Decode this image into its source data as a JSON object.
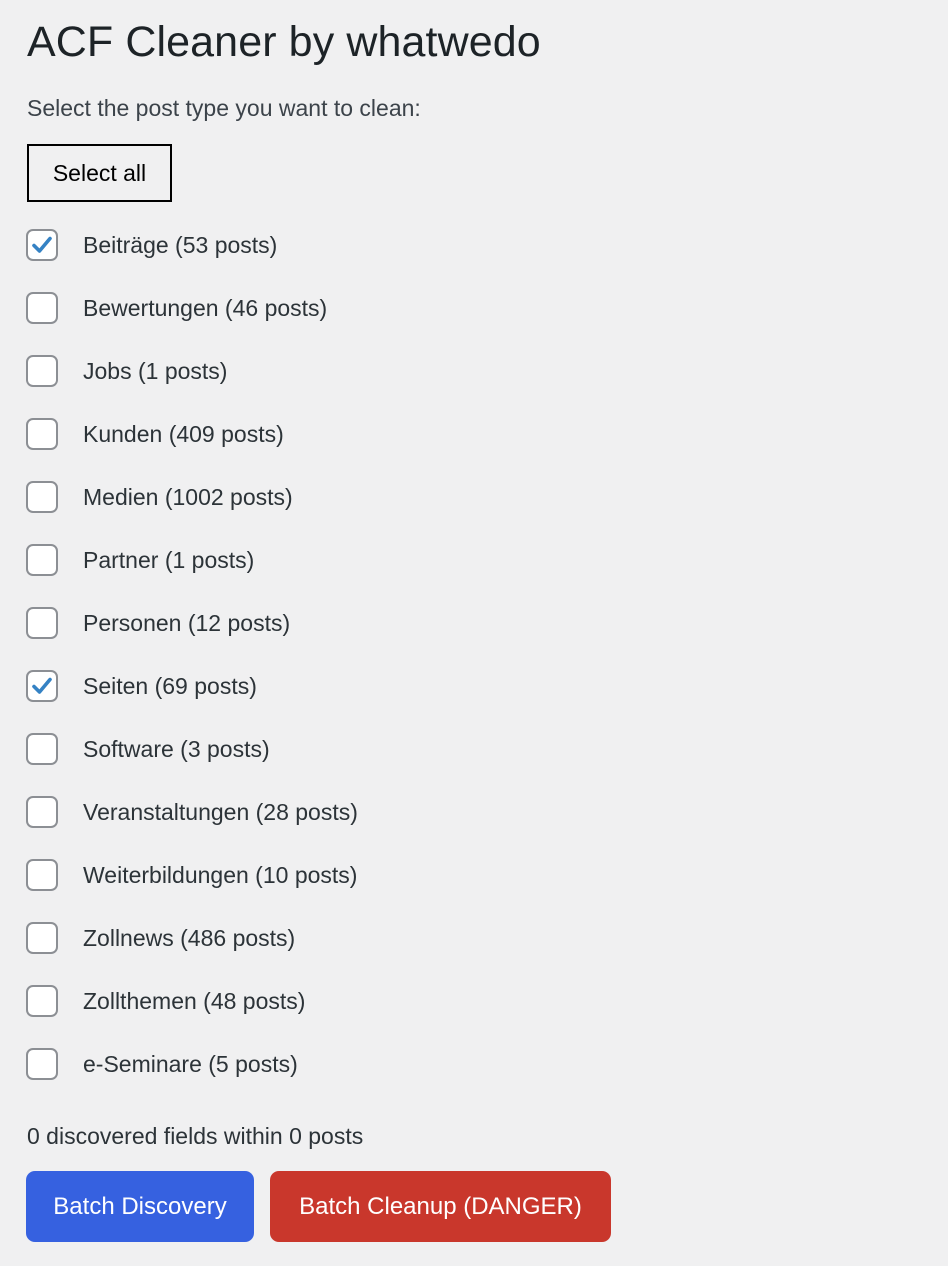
{
  "page": {
    "title": "ACF Cleaner by whatwedo",
    "subtitle": "Select the post type you want to clean:"
  },
  "toolbar": {
    "select_all_label": "Select all"
  },
  "post_types": [
    {
      "label": "Beiträge (53 posts)",
      "name": "Beiträge",
      "count": 53,
      "checked": true
    },
    {
      "label": "Bewertungen (46 posts)",
      "name": "Bewertungen",
      "count": 46,
      "checked": false
    },
    {
      "label": "Jobs (1 posts)",
      "name": "Jobs",
      "count": 1,
      "checked": false
    },
    {
      "label": "Kunden (409 posts)",
      "name": "Kunden",
      "count": 409,
      "checked": false
    },
    {
      "label": "Medien (1002 posts)",
      "name": "Medien",
      "count": 1002,
      "checked": false
    },
    {
      "label": "Partner (1 posts)",
      "name": "Partner",
      "count": 1,
      "checked": false
    },
    {
      "label": "Personen (12 posts)",
      "name": "Personen",
      "count": 12,
      "checked": false
    },
    {
      "label": "Seiten (69 posts)",
      "name": "Seiten",
      "count": 69,
      "checked": true
    },
    {
      "label": "Software (3 posts)",
      "name": "Software",
      "count": 3,
      "checked": false
    },
    {
      "label": "Veranstaltungen (28 posts)",
      "name": "Veranstaltungen",
      "count": 28,
      "checked": false
    },
    {
      "label": "Weiterbildungen (10 posts)",
      "name": "Weiterbildungen",
      "count": 10,
      "checked": false
    },
    {
      "label": "Zollnews (486 posts)",
      "name": "Zollnews",
      "count": 486,
      "checked": false
    },
    {
      "label": "Zollthemen (48 posts)",
      "name": "Zollthemen",
      "count": 48,
      "checked": false
    },
    {
      "label": "e-Seminare (5 posts)",
      "name": "e-Seminare",
      "count": 5,
      "checked": false
    }
  ],
  "status": {
    "text": "0 discovered fields within 0 posts",
    "fields": 0,
    "posts": 0
  },
  "actions": {
    "discovery_label": "Batch Discovery",
    "cleanup_label": "Batch Cleanup (DANGER)"
  },
  "colors": {
    "discovery": "#3661e0",
    "cleanup": "#c9372c",
    "checkmark": "#3582c4"
  },
  "icons": {
    "checkbox_checked": "checkmark-icon"
  }
}
